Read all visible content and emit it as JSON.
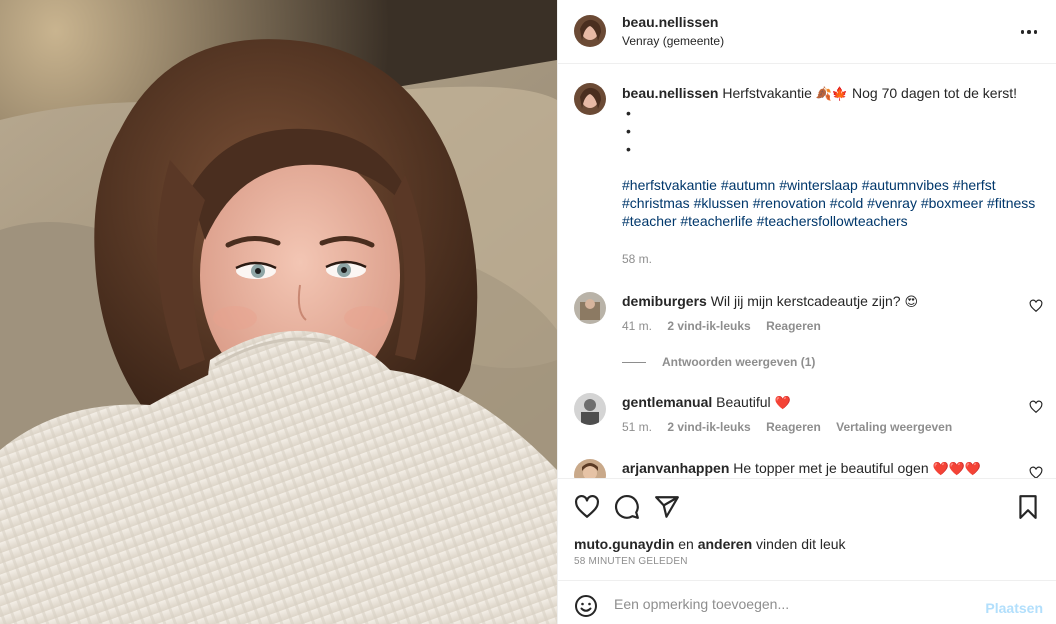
{
  "post": {
    "author": "beau.nellissen",
    "location": "Venray (gemeente)",
    "caption": {
      "text": "Herfstvakantie",
      "emoji": "🍂🍁",
      "text2": "Nog 70 dagen tot de kerst!",
      "bullets": [
        "•",
        "•",
        "•"
      ],
      "hashtags": [
        "#herfstvakantie",
        "#autumn",
        "#winterslaap",
        "#autumnvibes",
        "#herfst",
        "#christmas",
        "#klussen",
        "#renovation",
        "#cold",
        "#venray",
        "#boxmeer",
        "#fitness",
        "#teacher",
        "#teacherlife",
        "#teachersfollowteachers"
      ],
      "time": "58 m."
    }
  },
  "comments": [
    {
      "user": "demiburgers",
      "text": "Wil jij mijn kerstcadeautje zijn?",
      "emoji": "😍",
      "time": "41 m.",
      "likes": "2 vind-ik-leuks",
      "reply": "Reageren",
      "translate": ""
    },
    {
      "user": "gentlemanual",
      "text": "Beautiful",
      "emoji": "❤️",
      "time": "51 m.",
      "likes": "2 vind-ik-leuks",
      "reply": "Reageren",
      "translate": "Vertaling weergeven"
    },
    {
      "user": "arjanvanhappen",
      "text": "He topper met je beautiful ogen",
      "emoji": "❤️❤️❤️"
    }
  ],
  "view_replies": "Antwoorden weergeven (1)",
  "likes_line": {
    "user": "muto.gunaydin",
    "and": "en",
    "others": "anderen",
    "suffix": "vinden dit leuk"
  },
  "posted_ago": "58 MINUTEN GELEDEN",
  "add_comment": {
    "placeholder": "Een opmerking toevoegen...",
    "post_label": "Plaatsen"
  },
  "icons": [
    "heart-icon",
    "comment-icon",
    "share-icon",
    "bookmark-icon",
    "emoji-icon",
    "more-icon"
  ],
  "colors": {
    "link": "#00376b",
    "muted": "#8e8e8e",
    "post_disabled": "#b2dffc",
    "heart_red": "#ed4956"
  }
}
